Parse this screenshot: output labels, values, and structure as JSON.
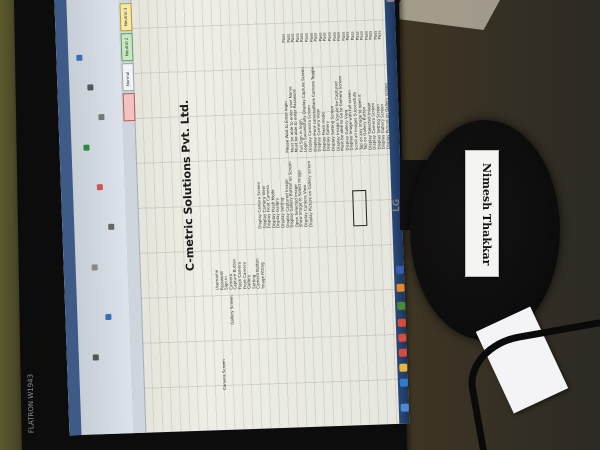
{
  "monitor": {
    "brand": "LG",
    "brand_left": "FLATRON W1943"
  },
  "spreadsheet": {
    "company_title": "C-metric Solutions Pvt. Ltd.",
    "sheet_tabs": [
      "Normal",
      "Neutral 2",
      "Neutral 3"
    ],
    "sections": [
      "Camera Screen",
      "Gallery Screen"
    ],
    "column_a": [
      "Username",
      "Password",
      "Sign in",
      "Camera",
      "Capture Button",
      "Flash Camera",
      "Front Camera",
      "Gallery",
      "Setting",
      "Camera Button",
      "Image Fitting"
    ],
    "column_b": [
      "Display Camera Screen",
      "Display Camera View",
      "Display Front Camera",
      "Display Flash Mode",
      "Display Gallery",
      "Display Setting",
      "Display Captured Image",
      "Display Gallery Button on Screen",
      "Open Selected Image",
      "Show image to Select Image",
      "Display Camera View",
      "Display Picture on Gallery screen"
    ],
    "column_c": [
      "Please Wait to Enter login",
      "Must be able to enter user Name",
      "Must be able to enter Password",
      "Full Sign in login",
      "Login Successfully Display Capture Screen",
      "Display Camera Screen",
      "Display Front camera/Back Camera Toggle",
      "Display Camera View",
      "Display Flash mode",
      "Display Gallery",
      "Display Setting Screen",
      "Display Image Should be Captured",
      "Must be able to Go to Camera Screen",
      "Display Gallery View",
      "Display Image with full screen",
      "Scroll all images Successfully",
      "Tap on any image to open it",
      "Tap on Gallery Button",
      "Display Selected Image",
      "Display Camera Screen",
      "Display Setting Screen",
      "Display Gallery Screen",
      "Display Picture on Gallery screen"
    ],
    "column_d": [
      "Pass",
      "Pass",
      "Pass",
      "Pass",
      "Pass",
      "Pass",
      "Pass",
      "Pass",
      "Pass",
      "Pass",
      "Pass",
      "Pass",
      "Pass",
      "Pass",
      "Pass",
      "Pass",
      "Pass",
      "Pass",
      "Pass",
      "Pass",
      "Pass",
      "Pass"
    ]
  },
  "name_card": {
    "text": "Nimesh Thakkar"
  }
}
